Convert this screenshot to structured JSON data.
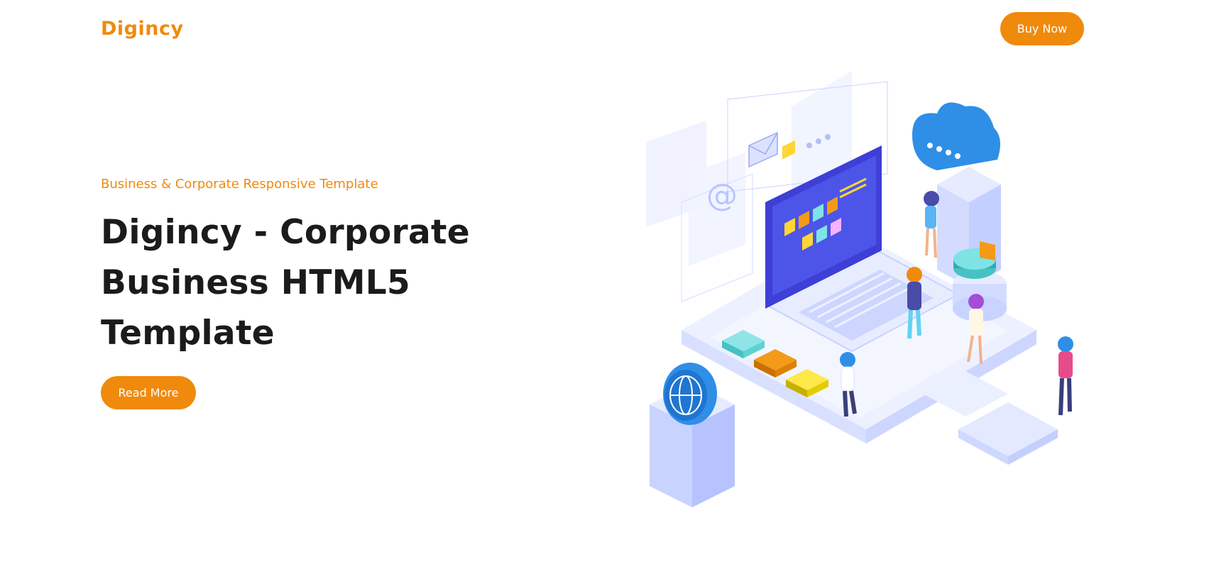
{
  "header": {
    "logo_text": "Digincy",
    "buy_button": "Buy Now"
  },
  "hero": {
    "subtitle": "Business & Corporate Responsive Template",
    "title_lines": [
      "Digincy - Corporate",
      "Business HTML5",
      "Template"
    ],
    "read_more_button": "Read More"
  },
  "illustration": {
    "at_symbol": "@"
  },
  "colors": {
    "accent": "#f08a0c",
    "heading": "#1b1b1b",
    "illustration_base": "#dfe6ff",
    "screen": "#3d3fd6",
    "cloud": "#2f8ee6"
  },
  "icons": [
    "envelope-icon",
    "at-icon",
    "cloud-icon",
    "globe-icon",
    "pie-chart-icon"
  ]
}
